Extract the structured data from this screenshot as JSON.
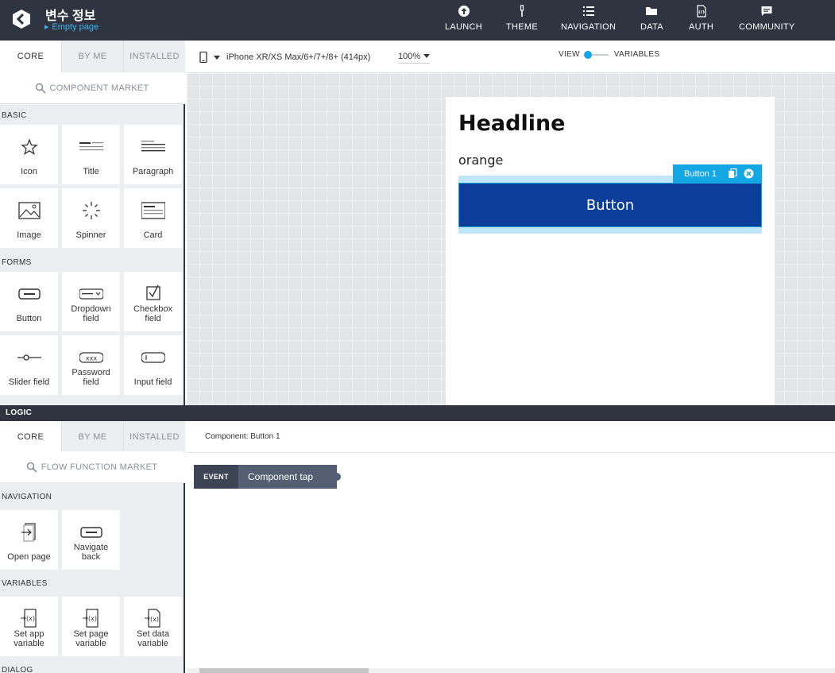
{
  "header": {
    "app_title": "변수 정보",
    "page_name": "Empty page",
    "nav": [
      {
        "label": "LAUNCH",
        "icon": "launch-icon"
      },
      {
        "label": "THEME",
        "icon": "theme-brush-icon"
      },
      {
        "label": "NAVIGATION",
        "icon": "navigation-list-icon"
      },
      {
        "label": "DATA",
        "icon": "data-folder-icon"
      },
      {
        "label": "AUTH",
        "icon": "auth-file-icon"
      },
      {
        "label": "COMMUNITY",
        "icon": "community-chat-icon"
      }
    ]
  },
  "ui_panel": {
    "tabs": [
      "CORE",
      "BY ME",
      "INSTALLED"
    ],
    "market": "COMPONENT MARKET",
    "sections": {
      "basic": "BASIC",
      "forms": "FORMS"
    },
    "basic_items": [
      {
        "label": "Icon",
        "icon": "star-icon"
      },
      {
        "label": "Title",
        "icon": "title-icon"
      },
      {
        "label": "Paragraph",
        "icon": "paragraph-icon"
      },
      {
        "label": "Image",
        "icon": "image-icon"
      },
      {
        "label": "Spinner",
        "icon": "spinner-icon"
      },
      {
        "label": "Card",
        "icon": "card-icon"
      }
    ],
    "form_items": [
      {
        "label": "Button",
        "icon": "button-icon"
      },
      {
        "label": "Dropdown field",
        "icon": "dropdown-icon"
      },
      {
        "label": "Checkbox field",
        "icon": "checkbox-icon"
      },
      {
        "label": "Slider field",
        "icon": "slider-icon"
      },
      {
        "label": "Password field",
        "icon": "password-icon"
      },
      {
        "label": "Input field",
        "icon": "input-icon"
      }
    ]
  },
  "toolbar": {
    "device": "iPhone XR/XS Max/6+/7+/8+ (414px)",
    "zoom": "100%",
    "view_label": "VIEW",
    "variables_label": "VARIABLES"
  },
  "canvas": {
    "headline": "Headline",
    "text": "orange",
    "selected_label": "Button 1",
    "button_text": "Button"
  },
  "logic": {
    "bar_title": "LOGIC",
    "tabs": [
      "CORE",
      "BY ME",
      "INSTALLED"
    ],
    "market": "FLOW FUNCTION MARKET",
    "sections": {
      "navigation": "NAVIGATION",
      "variables": "VARIABLES",
      "dialog": "DIALOG"
    },
    "navigation_items": [
      {
        "label": "Open page",
        "icon": "open-page-icon"
      },
      {
        "label": "Navigate back",
        "icon": "navigate-back-icon"
      }
    ],
    "variable_items": [
      {
        "label": "Set app variable",
        "icon": "set-app-variable-icon"
      },
      {
        "label": "Set page variable",
        "icon": "set-page-variable-icon"
      },
      {
        "label": "Set data variable",
        "icon": "set-data-variable-icon"
      }
    ],
    "component_title": "Component: Button 1",
    "event_tag": "EVENT",
    "event_name": "Component tap"
  },
  "colors": {
    "topbar": "#2f3441",
    "accent": "#14a7e6",
    "button": "#0b3d9b",
    "canvas_bg": "#e3e5e8"
  }
}
